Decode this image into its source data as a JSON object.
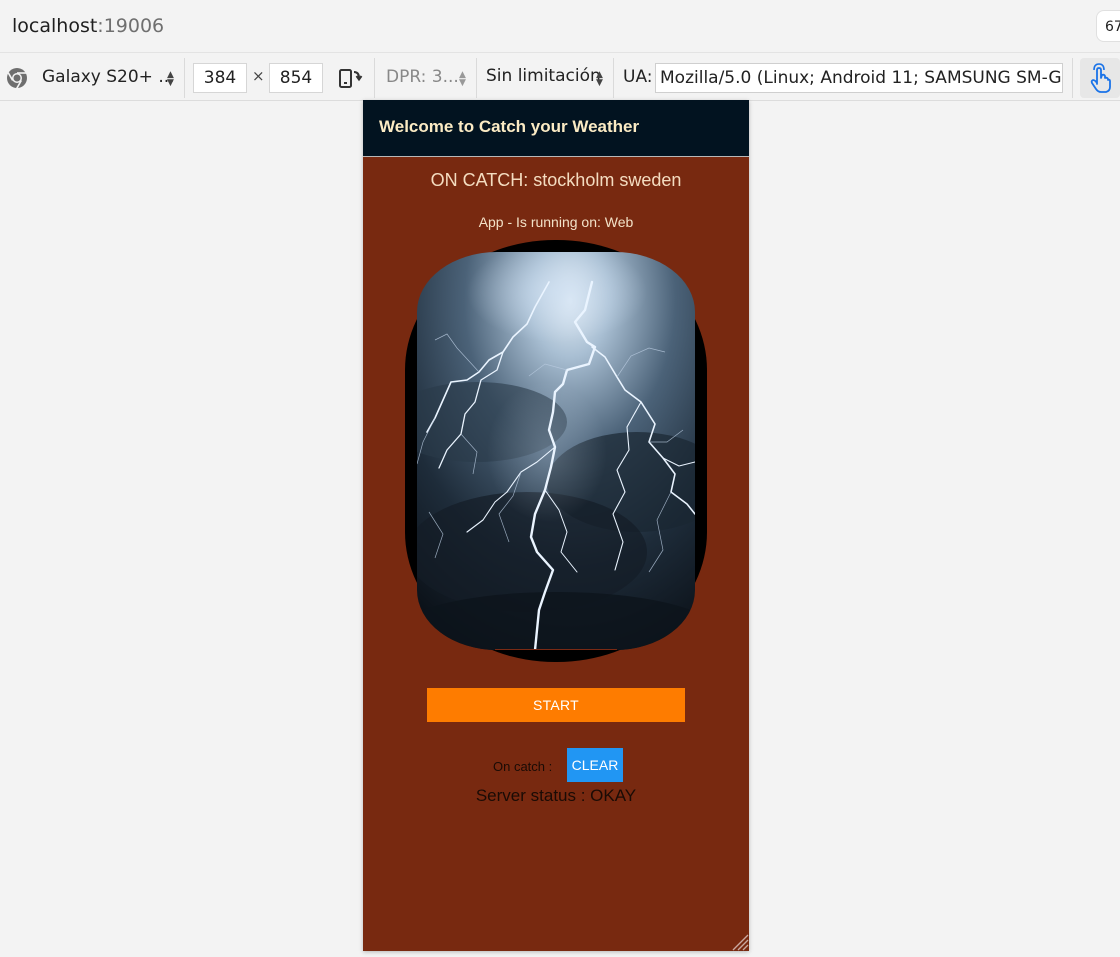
{
  "browser": {
    "host": "localhost",
    "port": ":19006",
    "zoom_partial": "67"
  },
  "devtools": {
    "device": "Galaxy S20+ ...",
    "width": "384",
    "height": "854",
    "times": "×",
    "dpr": "DPR: 3...",
    "throttling": "Sin limitación",
    "ua_label": "UA:",
    "ua_value": "Mozilla/5.0 (Linux; Android 11; SAMSUNG SM-G97"
  },
  "app": {
    "title": "Welcome to Catch your Weather",
    "on_catch_title": "ON CATCH: stockholm sweden",
    "running_on": "App - Is running on:  Web",
    "start_label": "START",
    "on_catch_label": "On catch :",
    "clear_label": "CLEAR",
    "server_status": "Server status : OKAY",
    "colors": {
      "background": "#782910",
      "header": "#021320",
      "start_button": "#fe7c00",
      "clear_button": "#2196f3"
    }
  }
}
